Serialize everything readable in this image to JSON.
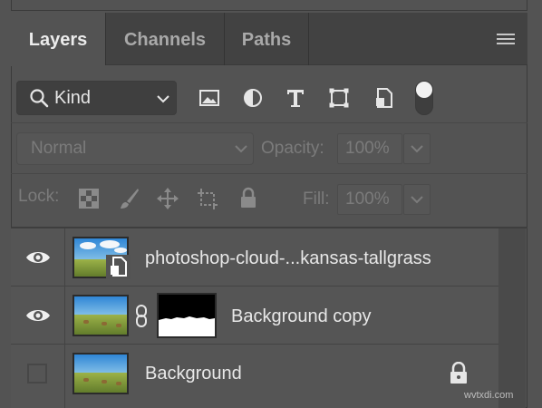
{
  "tabs": [
    {
      "label": "Layers",
      "active": true
    },
    {
      "label": "Channels",
      "active": false
    },
    {
      "label": "Paths",
      "active": false
    }
  ],
  "filter": {
    "kind_label": "Kind",
    "icons": [
      "image-filter-icon",
      "adjustment-filter-icon",
      "type-filter-icon",
      "shape-filter-icon",
      "smart-object-filter-icon"
    ],
    "toggle_on": true
  },
  "blend": {
    "mode": "Normal",
    "opacity_label": "Opacity:",
    "opacity_value": "100%"
  },
  "lock": {
    "label": "Lock:",
    "fill_label": "Fill:",
    "fill_value": "100%"
  },
  "layers": [
    {
      "name": "photoshop-cloud-...kansas-tallgrass",
      "visible": true,
      "smart_object": true,
      "has_mask": false,
      "locked": false
    },
    {
      "name": "Background copy",
      "visible": true,
      "smart_object": false,
      "has_mask": true,
      "locked": false
    },
    {
      "name": "Background",
      "visible": false,
      "smart_object": false,
      "has_mask": false,
      "locked": true
    }
  ],
  "watermark": "wvtxdi.com",
  "colors": {
    "panel": "#535353",
    "tabbar": "#424242",
    "text": "#e8e8e8",
    "dim": "#7b7b7b"
  }
}
